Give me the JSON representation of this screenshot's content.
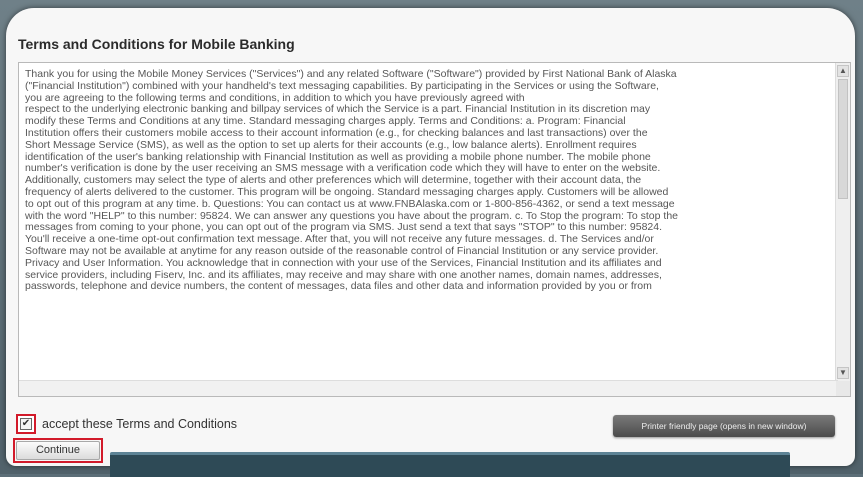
{
  "page": {
    "title": "Terms and Conditions for Mobile Banking"
  },
  "terms": {
    "lines": [
      "Thank you for using the Mobile Money Services (\"Services\") and any related Software (\"Software\") provided by First National Bank of Alaska",
      "(\"Financial Institution\") combined with your handheld's text messaging capabilities. By participating in the Services or using the Software,",
      "you are agreeing to the following terms and conditions, in addition to which you have previously agreed with",
      "respect to the underlying electronic banking and billpay services of which the Service is a part. Financial Institution in its discretion may",
      "modify these Terms and Conditions at any time. Standard messaging charges apply. Terms and Conditions: a. Program: Financial",
      "Institution offers their customers mobile access to their account information (e.g., for checking balances and last transactions) over the",
      "Short Message Service (SMS), as well as the option to set up alerts for their accounts (e.g., low balance alerts). Enrollment requires",
      "identification of the user's banking relationship with Financial Institution as well as providing a mobile phone number. The mobile phone",
      "number's verification is done by the user receiving an SMS message with a verification code which they will have to enter on the website.",
      "Additionally, customers may select the type of alerts and other preferences which will determine, together with their account data, the",
      "frequency of alerts delivered to the customer. This program will be ongoing. Standard messaging charges apply. Customers will be allowed",
      "to opt out of this program at any time. b. Questions: You can contact us at www.FNBAlaska.com or 1-800-856-4362, or send a text message",
      "with the word \"HELP\" to this number: 95824. We can answer any questions you have about the program. c. To Stop the program: To stop the",
      "messages from coming to your phone, you can opt out of the program via SMS. Just send a text that says \"STOP\" to this number: 95824.",
      "You'll receive a one-time opt-out confirmation text message. After that, you will not receive any future messages. d. The Services and/or",
      "Software may not be available at anytime for any reason outside of the reasonable control of Financial Institution or any service provider.",
      "Privacy and User Information. You acknowledge that in connection with your use of the Services, Financial Institution and its affiliates and",
      "service providers, including Fiserv, Inc. and its affiliates, may receive and may share with one another names, domain names, addresses,",
      "passwords, telephone and device numbers, the content of messages, data files and other data and information provided by you or from"
    ]
  },
  "accept": {
    "label": "accept these Terms and Conditions",
    "checked": true,
    "check_glyph": "✔"
  },
  "buttons": {
    "continue_label": "Continue",
    "printer_label": "Printer friendly page (opens in new window)"
  },
  "scrollbar": {
    "up_glyph": "▲",
    "down_glyph": "▼"
  },
  "colors": {
    "highlight": "#d21a2a",
    "footer": "#2e4a56"
  }
}
